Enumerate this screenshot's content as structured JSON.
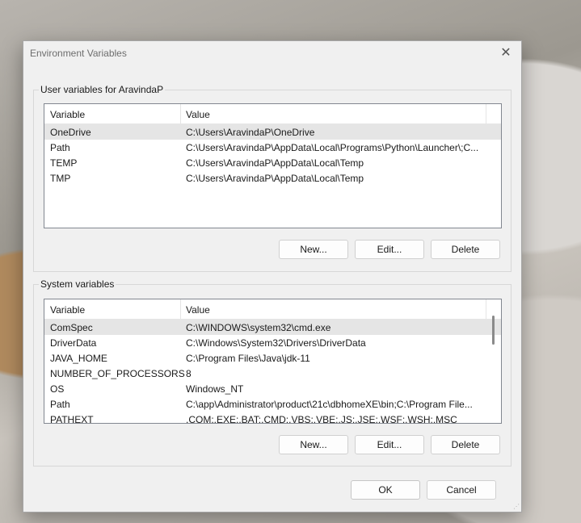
{
  "window": {
    "title": "Environment Variables",
    "close_icon": "close-icon"
  },
  "user_group": {
    "label": "User variables for AravindaP",
    "headers": {
      "variable": "Variable",
      "value": "Value"
    },
    "rows": [
      {
        "variable": "OneDrive",
        "value": "C:\\Users\\AravindaP\\OneDrive"
      },
      {
        "variable": "Path",
        "value": "C:\\Users\\AravindaP\\AppData\\Local\\Programs\\Python\\Launcher\\;C..."
      },
      {
        "variable": "TEMP",
        "value": "C:\\Users\\AravindaP\\AppData\\Local\\Temp"
      },
      {
        "variable": "TMP",
        "value": "C:\\Users\\AravindaP\\AppData\\Local\\Temp"
      }
    ],
    "buttons": {
      "new": "New...",
      "edit": "Edit...",
      "delete": "Delete"
    }
  },
  "system_group": {
    "label": "System variables",
    "headers": {
      "variable": "Variable",
      "value": "Value"
    },
    "rows": [
      {
        "variable": "ComSpec",
        "value": "C:\\WINDOWS\\system32\\cmd.exe"
      },
      {
        "variable": "DriverData",
        "value": "C:\\Windows\\System32\\Drivers\\DriverData"
      },
      {
        "variable": "JAVA_HOME",
        "value": "C:\\Program Files\\Java\\jdk-11"
      },
      {
        "variable": "NUMBER_OF_PROCESSORS",
        "value": "8"
      },
      {
        "variable": "OS",
        "value": "Windows_NT"
      },
      {
        "variable": "Path",
        "value": "C:\\app\\Administrator\\product\\21c\\dbhomeXE\\bin;C:\\Program File..."
      },
      {
        "variable": "PATHEXT",
        "value": ".COM;.EXE;.BAT;.CMD;.VBS;.VBE;.JS;.JSE;.WSF;.WSH;.MSC"
      }
    ],
    "buttons": {
      "new": "New...",
      "edit": "Edit...",
      "delete": "Delete"
    }
  },
  "footer": {
    "ok": "OK",
    "cancel": "Cancel"
  }
}
